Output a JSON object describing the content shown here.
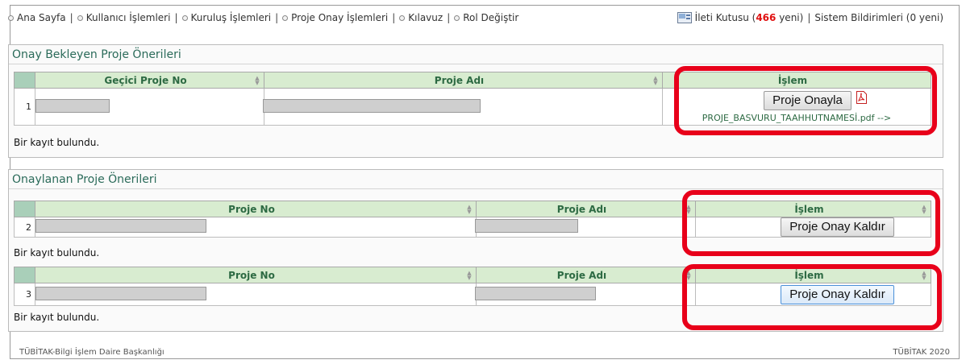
{
  "nav": {
    "items": [
      {
        "label": "Ana Sayfa"
      },
      {
        "label": "Kullanıcı İşlemleri"
      },
      {
        "label": "Kuruluş İşlemleri"
      },
      {
        "label": "Proje Onay İşlemleri"
      },
      {
        "label": "Kılavuz"
      },
      {
        "label": "Rol Değiştir"
      }
    ],
    "separator": "|",
    "inbox_label": "İleti Kutusu (",
    "inbox_count": "466",
    "inbox_suffix": " yeni)",
    "system_notifications": "Sistem Bildirimleri (0 yeni)"
  },
  "pending": {
    "title": "Onay Bekleyen Proje Önerileri",
    "columns": {
      "temp_no": "Geçici Proje No",
      "name": "Proje Adı",
      "action": "İşlem"
    },
    "row": {
      "index": "1",
      "button": "Proje Onayla",
      "pdf_link": "PROJE_BASVURU_TAAHHUTNAMESİ.pdf -->"
    },
    "found": "Bir kayıt bulundu."
  },
  "approved": {
    "title": "Onaylanan Proje Önerileri",
    "tables": [
      {
        "columns": {
          "no": "Proje No",
          "name": "Proje Adı",
          "action": "İşlem"
        },
        "row": {
          "index": "2",
          "button": "Proje Onay Kaldır"
        },
        "found": "Bir kayıt bulundu."
      },
      {
        "columns": {
          "no": "Proje No",
          "name": "Proje Adı",
          "action": "İşlem"
        },
        "row": {
          "index": "3",
          "button": "Proje Onay Kaldır"
        },
        "found": "Bir kayıt bulundu."
      }
    ]
  },
  "footer": {
    "left": "TÜBİTAK-Bilgi İşlem Daire Başkanlığı",
    "right": "TÜBİTAK 2020"
  },
  "colors": {
    "header_bg": "#d8ecd0",
    "accent": "#2b6b5a",
    "highlight": "#e8001a",
    "inbox_count": "#e01010"
  }
}
